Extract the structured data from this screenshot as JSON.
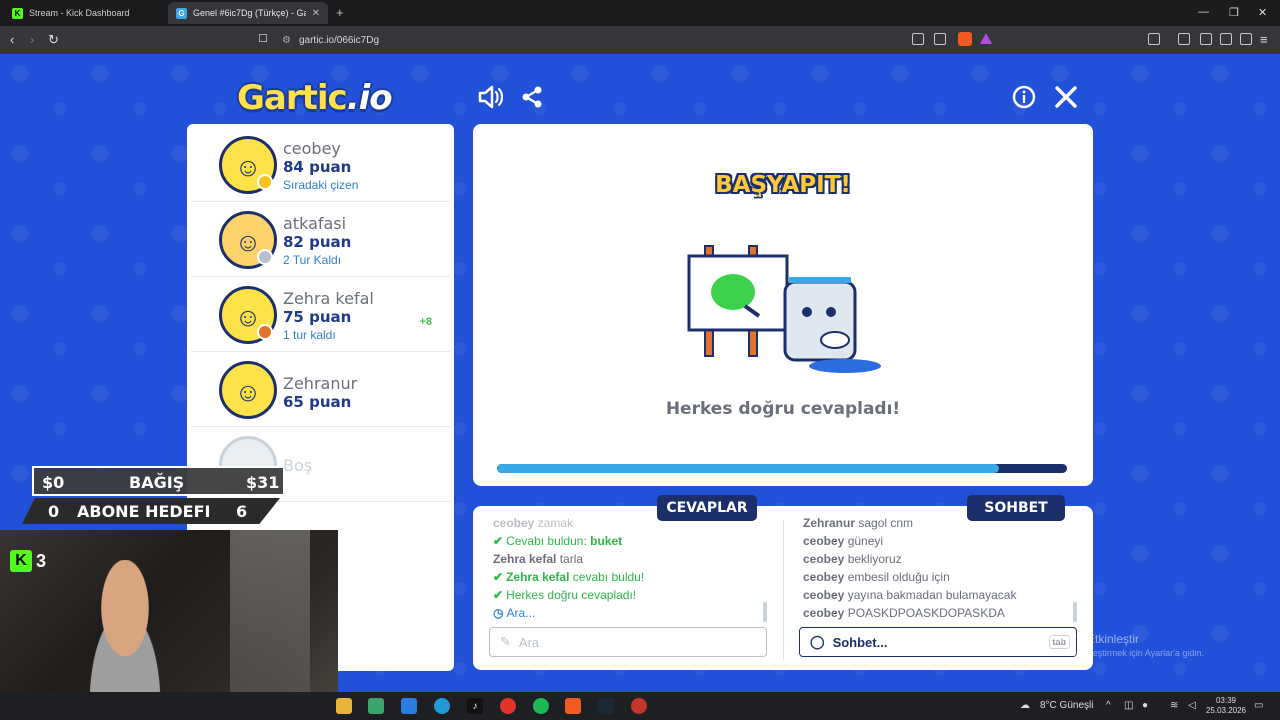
{
  "browser": {
    "tabs": [
      {
        "title": "Stream - Kick Dashboard",
        "icon": "kick-icon"
      },
      {
        "title": "Genel #6ic7Dg (Türkçe) - Gar",
        "icon": "gartic-icon"
      }
    ],
    "url": "gartic.io/066ic7Dg"
  },
  "game": {
    "logo_main": "Gartic",
    "logo_io": ".io",
    "players": [
      {
        "name": "ceobey",
        "points": "84 puan",
        "status": "Sıradaki çizen",
        "bonus": "",
        "badge": "#f7c21c"
      },
      {
        "name": "atkafasi",
        "points": "82 puan",
        "status": "2 Tur Kaldı",
        "bonus": "",
        "badge": "#b8c1cb"
      },
      {
        "name": "Zehra kefal",
        "points": "75 puan",
        "status": "1 tur kaldı",
        "bonus": "+8",
        "badge": "#e3732a"
      },
      {
        "name": "Zehranur",
        "points": "65 puan",
        "status": "",
        "bonus": "",
        "badge": ""
      }
    ],
    "empty_slot": "Boş",
    "board": {
      "headline": "BAŞYAPIT!",
      "message": "Herkes doğru cevapladı!",
      "progress": 0.88
    },
    "answers": {
      "tab": "CEVAPLAR",
      "lines": [
        {
          "name": "ceobey",
          "text": "zamak",
          "kind": "faded"
        },
        {
          "name": "",
          "text": "Cevabı buldun: ",
          "bold": "buket",
          "kind": "ok"
        },
        {
          "name": "Zehra kefal",
          "text": "tarla",
          "kind": "plain"
        },
        {
          "name": "",
          "text": "cevabı buldu!",
          "bold": "Zehra kefal",
          "kind": "ok-name"
        },
        {
          "name": "",
          "text": "Herkes doğru cevapladı!",
          "kind": "ok"
        },
        {
          "name": "",
          "text": "Ara...",
          "kind": "wait"
        }
      ],
      "placeholder": "Ara"
    },
    "chat": {
      "tab": "SOHBET",
      "lines": [
        {
          "name": "Zehranur",
          "text": "sagol cnm"
        },
        {
          "name": "ceobey",
          "text": "güneyi"
        },
        {
          "name": "ceobey",
          "text": "bekliyoruz"
        },
        {
          "name": "ceobey",
          "text": "embesil olduğu için"
        },
        {
          "name": "ceobey",
          "text": "yayına bakmadan bulamayacak"
        },
        {
          "name": "ceobey",
          "text": "POASKDPOASKDOPASKDA"
        }
      ],
      "placeholder": "Sohbet...",
      "tab_hint": "tab"
    }
  },
  "overlay": {
    "donation_left": "$0",
    "donation_label": "BAĞIŞ",
    "donation_right": "$31",
    "sub_left": "0",
    "sub_label": "ABONE HEDEFI",
    "sub_right": "6",
    "kick_count": "3"
  },
  "watermark": {
    "line1": "Windows'u Etkinleştir",
    "line2": "Windows'u etkinleştirmek için Ayarlar'a gidin."
  },
  "taskbar": {
    "weather": "8°C  Güneşli",
    "time": "03:39",
    "date": "25.03.2026"
  }
}
